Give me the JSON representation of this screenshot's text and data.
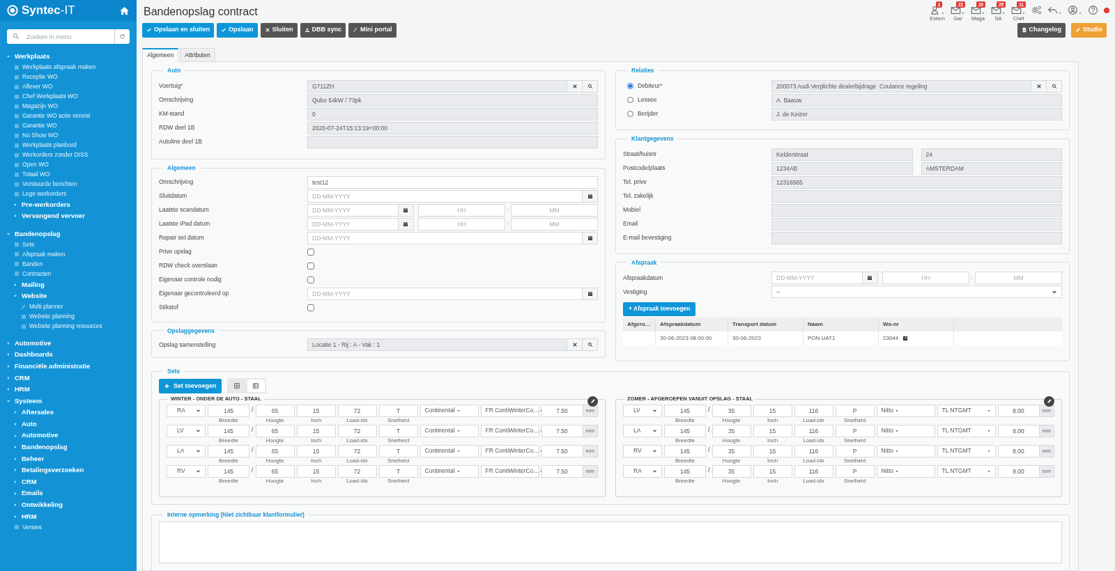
{
  "sidebar": {
    "brand": "**Syntec**-IT",
    "search": {
      "placeholder": "Zoeken in menu"
    },
    "items": [
      {
        "kind": "group",
        "label": "Werkplaats",
        "expanded": true,
        "children": [
          {
            "kind": "link",
            "label": "Werkplaats afspraak maken"
          },
          {
            "kind": "link",
            "label": "Receptie WO"
          },
          {
            "kind": "link",
            "label": "Aflever WO"
          },
          {
            "kind": "link",
            "label": "Chef Werkplaats WO"
          },
          {
            "kind": "link",
            "label": "Magazijn WO"
          },
          {
            "kind": "link",
            "label": "Garantie WO actie vereist"
          },
          {
            "kind": "link",
            "label": "Garantie WO"
          },
          {
            "kind": "link",
            "label": "No Show WO"
          },
          {
            "kind": "link",
            "label": "Werkplaats planbord"
          },
          {
            "kind": "link",
            "label": "Werkorders zonder DISS"
          },
          {
            "kind": "link",
            "label": "Open WO"
          },
          {
            "kind": "link",
            "label": "Totaal WO"
          },
          {
            "kind": "link",
            "label": "Verstuurde berichten"
          },
          {
            "kind": "link",
            "label": "Lege werkorders"
          },
          {
            "kind": "group",
            "label": "Pre-werkorders",
            "expanded": false
          },
          {
            "kind": "group",
            "label": "Vervangend vervoer",
            "expanded": false
          }
        ]
      },
      {
        "kind": "group",
        "label": "Bandenopslag",
        "expanded": true,
        "children": [
          {
            "kind": "link",
            "label": "Sets"
          },
          {
            "kind": "link",
            "label": "Afspraak maken"
          },
          {
            "kind": "link",
            "label": "Banden"
          },
          {
            "kind": "link",
            "label": "Contracten"
          },
          {
            "kind": "group",
            "label": "Mailing",
            "expanded": false
          },
          {
            "kind": "group",
            "label": "Website",
            "expanded": true,
            "children": [
              {
                "kind": "tool",
                "label": "Multi planner"
              },
              {
                "kind": "link",
                "label": "Website planning"
              },
              {
                "kind": "link",
                "label": "Website planning resources"
              }
            ]
          }
        ]
      },
      {
        "kind": "group",
        "label": "Automotive",
        "expanded": false
      },
      {
        "kind": "group",
        "label": "Dashboards",
        "expanded": false
      },
      {
        "kind": "group",
        "label": "Financiële administratie",
        "expanded": false
      },
      {
        "kind": "group",
        "label": "CRM",
        "expanded": false
      },
      {
        "kind": "group",
        "label": "HRM",
        "expanded": false
      },
      {
        "kind": "group",
        "label": "Systeem",
        "expanded": true,
        "children": [
          {
            "kind": "group",
            "label": "Aftersales",
            "expanded": false
          },
          {
            "kind": "group",
            "label": "Auto",
            "expanded": false
          },
          {
            "kind": "group",
            "label": "Automotive",
            "expanded": false
          },
          {
            "kind": "group",
            "label": "Bandenopslag",
            "expanded": false
          },
          {
            "kind": "group",
            "label": "Beheer",
            "expanded": false
          },
          {
            "kind": "group",
            "label": "Betalingsverzoeken",
            "expanded": false
          },
          {
            "kind": "group",
            "label": "CRM",
            "expanded": false
          },
          {
            "kind": "group",
            "label": "Emails",
            "expanded": false
          },
          {
            "kind": "group",
            "label": "Ontwikkeling",
            "expanded": false
          },
          {
            "kind": "group",
            "label": "HRM",
            "expanded": false
          },
          {
            "kind": "link",
            "label": "Versies"
          }
        ]
      }
    ]
  },
  "header": {
    "title": "Bandenopslag contract",
    "notifications": [
      {
        "kind": "user",
        "label": "Extern",
        "count": "1"
      },
      {
        "kind": "mail",
        "label": "Gar",
        "count": "22"
      },
      {
        "kind": "mail",
        "label": "Maga",
        "count": "30"
      },
      {
        "kind": "mail",
        "label": "SA",
        "count": "25"
      },
      {
        "kind": "mail",
        "label": "Chef",
        "count": "11"
      }
    ],
    "toolbar": [
      {
        "kind": "primary",
        "label": "Opslaan en sluiten"
      },
      {
        "kind": "primary",
        "label": "Opslaan"
      },
      {
        "kind": "dark",
        "label": "Sluiten"
      },
      {
        "kind": "dark",
        "label": "DBB sync"
      },
      {
        "kind": "dark",
        "label": "Mini portal"
      }
    ],
    "right_toolbar": [
      {
        "kind": "dark",
        "label": "Changelog"
      },
      {
        "kind": "warning",
        "label": "Studio"
      }
    ]
  },
  "tabs": [
    {
      "label": "Algemeen",
      "selected": true
    },
    {
      "label": "Attributen",
      "selected": false
    }
  ],
  "auto": {
    "legend": "Auto",
    "fields": [
      {
        "label": "Voertuig",
        "required_mark": "*",
        "kind": "lookup",
        "value": "G711ZH"
      },
      {
        "label": "Omschrijving",
        "kind": "readonly",
        "value": "Qubo 54kW / 73pk"
      },
      {
        "label": "KM-stand",
        "kind": "readonly",
        "value": "0"
      },
      {
        "label": "RDW deel 1B",
        "kind": "readonly",
        "value": "2020-07-24T15:13:19+00:00"
      },
      {
        "label": "Autoline deel 1B",
        "kind": "readonly"
      }
    ]
  },
  "algemeen": {
    "legend": "Algemeen",
    "fields": [
      {
        "label": "Omschrijving",
        "kind": "text",
        "value": "test12"
      },
      {
        "label": "Sluitdatum",
        "kind": "date",
        "placeholder": "DD-MM-YYYY"
      },
      {
        "label": "Laatste scandatum",
        "kind": "datetime",
        "placeholder": "DD-MM-YYYY",
        "hour_placeholder": "HH",
        "separator": ":",
        "minute_placeholder": "MM"
      },
      {
        "label": "Laatste iPad datum",
        "kind": "datetime",
        "placeholder": "DD-MM-YYYY",
        "hour_placeholder": "HH",
        "separator": ":",
        "minute_placeholder": "MM"
      },
      {
        "label": "Repair set datum",
        "kind": "date",
        "placeholder": "DD-MM-YYYY"
      },
      {
        "label": "Prive opslag",
        "kind": "checkbox",
        "checked": false
      },
      {
        "label": "RDW check overslaan",
        "kind": "checkbox",
        "checked": false
      },
      {
        "label": "Eigenaar controle nodig",
        "kind": "checkbox",
        "checked": false
      },
      {
        "label": "Eigenaar gecontroleerd op",
        "kind": "date",
        "placeholder": "DD-MM-YYYY"
      },
      {
        "label": "Stikstof",
        "kind": "checkbox",
        "checked": false
      }
    ]
  },
  "opslaggegevens": {
    "legend": "Opslaggegevens",
    "fields": [
      {
        "label": "Opslag samenstelling",
        "kind": "lookup",
        "value": "Locatie 1 - Rij : A - Vak : 1"
      }
    ]
  },
  "relaties": {
    "legend": "Relaties",
    "rows": [
      {
        "label": "Debiteur",
        "required_mark": "*",
        "selected": true,
        "kind": "lookup",
        "value": "200073 Audi Verplichte dealerbijdrage  Coulance regeling"
      },
      {
        "label": "Lessee",
        "selected": false,
        "kind": "readonly",
        "value": "A. Baauw"
      },
      {
        "label": "Berijder",
        "selected": false,
        "kind": "readonly",
        "value": "J. de Keizer"
      }
    ]
  },
  "klantgegevens": {
    "legend": "Klantgegevens",
    "fields": [
      {
        "label": "Straat/huisnr",
        "kind": "pair",
        "values": [
          "Kelderstraat",
          "24"
        ]
      },
      {
        "label": "Postcode/plaats",
        "kind": "pair",
        "values": [
          "1234AB",
          "AMSTERDAM"
        ]
      },
      {
        "label": "Tel. prive",
        "kind": "readonly",
        "value": "12316565"
      },
      {
        "label": "Tel. zakelijk",
        "kind": "readonly"
      },
      {
        "label": "Mobiel",
        "kind": "readonly"
      },
      {
        "label": "Email",
        "kind": "readonly"
      },
      {
        "label": "E-mail bevestiging",
        "kind": "readonly"
      }
    ]
  },
  "afspraak": {
    "legend": "Afspraak",
    "fields": [
      {
        "label": "Afspraakdatum",
        "kind": "datetime",
        "placeholder": "DD-MM-YYYY",
        "hour_placeholder": "HH",
        "separator": ":",
        "minute_placeholder": "MM"
      },
      {
        "label": "Vestiging",
        "kind": "select",
        "value": "--"
      }
    ],
    "add_button": "+ Afspraak toevoegen",
    "table": {
      "columns": [
        "Afgero…",
        "Afspraakdatum",
        "Transport datum",
        "Naam",
        "Wo-nr"
      ],
      "rows": [
        {
          "cells": [
            "",
            "30-06-2023 08:00:00",
            "30-06-2023",
            "PON UAT1",
            "23044"
          ]
        }
      ]
    }
  },
  "sets": {
    "legend": "Sets",
    "add_button": "Set toevoegen",
    "views": [
      {
        "selected": false
      },
      {
        "selected": true
      }
    ],
    "groups": [
      {
        "title": "WINTER - ONDER DE AUTO - STAAL",
        "tyres": [
          {
            "position": "RA",
            "sizes": [
              {
                "value": "145",
                "caption": "Breedte"
              },
              {
                "value": "65",
                "caption": "Hoogte"
              },
              {
                "value": "15",
                "caption": "Inch"
              },
              {
                "value": "72",
                "caption": "Load-idx"
              },
              {
                "value": "T",
                "caption": "Snelheid"
              }
            ],
            "separator": "/",
            "brand": "Continental",
            "model": "FR ContiWinterCo…",
            "depth": "7.50",
            "unit": "mm"
          },
          {
            "position": "LV",
            "sizes": [
              {
                "value": "145",
                "caption": "Breedte"
              },
              {
                "value": "65",
                "caption": "Hoogte"
              },
              {
                "value": "15",
                "caption": "Inch"
              },
              {
                "value": "72",
                "caption": "Load-idx"
              },
              {
                "value": "T",
                "caption": "Snelheid"
              }
            ],
            "separator": "/",
            "brand": "Continental",
            "model": "FR ContiWinterCo…",
            "depth": "7.50",
            "unit": "mm"
          },
          {
            "position": "LA",
            "sizes": [
              {
                "value": "145",
                "caption": "Breedte"
              },
              {
                "value": "65",
                "caption": "Hoogte"
              },
              {
                "value": "15",
                "caption": "Inch"
              },
              {
                "value": "72",
                "caption": "Load-idx"
              },
              {
                "value": "T",
                "caption": "Snelheid"
              }
            ],
            "separator": "/",
            "brand": "Continental",
            "model": "FR ContiWinterCo…",
            "depth": "7.50",
            "unit": "mm"
          },
          {
            "position": "RV",
            "sizes": [
              {
                "value": "145",
                "caption": "Breedte"
              },
              {
                "value": "65",
                "caption": "Hoogte"
              },
              {
                "value": "15",
                "caption": "Inch"
              },
              {
                "value": "72",
                "caption": "Load-idx"
              },
              {
                "value": "T",
                "caption": "Snelheid"
              }
            ],
            "separator": "/",
            "brand": "Continental",
            "model": "FR ContiWinterCo…",
            "depth": "7.50",
            "unit": "mm"
          }
        ]
      },
      {
        "title": "ZOMER - AFGEROEPEN VANUIT OPSLAG - STAAL",
        "tyres": [
          {
            "position": "LV",
            "sizes": [
              {
                "value": "145",
                "caption": "Breedte"
              },
              {
                "value": "35",
                "caption": "Hoogte"
              },
              {
                "value": "15",
                "caption": "Inch"
              },
              {
                "value": "116",
                "caption": "Load-idx"
              },
              {
                "value": "P",
                "caption": "Snelheid"
              }
            ],
            "separator": "/",
            "brand": "Nitto",
            "model": "TL NTGMT",
            "depth": "8.00",
            "unit": "mm"
          },
          {
            "position": "LA",
            "sizes": [
              {
                "value": "145",
                "caption": "Breedte"
              },
              {
                "value": "35",
                "caption": "Hoogte"
              },
              {
                "value": "15",
                "caption": "Inch"
              },
              {
                "value": "116",
                "caption": "Load-idx"
              },
              {
                "value": "P",
                "caption": "Snelheid"
              }
            ],
            "separator": "/",
            "brand": "Nitto",
            "model": "TL NTGMT",
            "depth": "8.00",
            "unit": "mm"
          },
          {
            "position": "RV",
            "sizes": [
              {
                "value": "145",
                "caption": "Breedte"
              },
              {
                "value": "35",
                "caption": "Hoogte"
              },
              {
                "value": "15",
                "caption": "Inch"
              },
              {
                "value": "116",
                "caption": "Load-idx"
              },
              {
                "value": "P",
                "caption": "Snelheid"
              }
            ],
            "separator": "/",
            "brand": "Nitto",
            "model": "TL NTGMT",
            "depth": "8.00",
            "unit": "mm"
          },
          {
            "position": "RA",
            "sizes": [
              {
                "value": "145",
                "caption": "Breedte"
              },
              {
                "value": "35",
                "caption": "Hoogte"
              },
              {
                "value": "15",
                "caption": "Inch"
              },
              {
                "value": "116",
                "caption": "Load-idx"
              },
              {
                "value": "P",
                "caption": "Snelheid"
              }
            ],
            "separator": "/",
            "brand": "Nitto",
            "model": "TL NTGMT",
            "depth": "8.00",
            "unit": "mm"
          }
        ]
      }
    ]
  },
  "interne_opmerking": {
    "legend": "Interne opmerking (Niet zichtbaar klantformulier)"
  }
}
